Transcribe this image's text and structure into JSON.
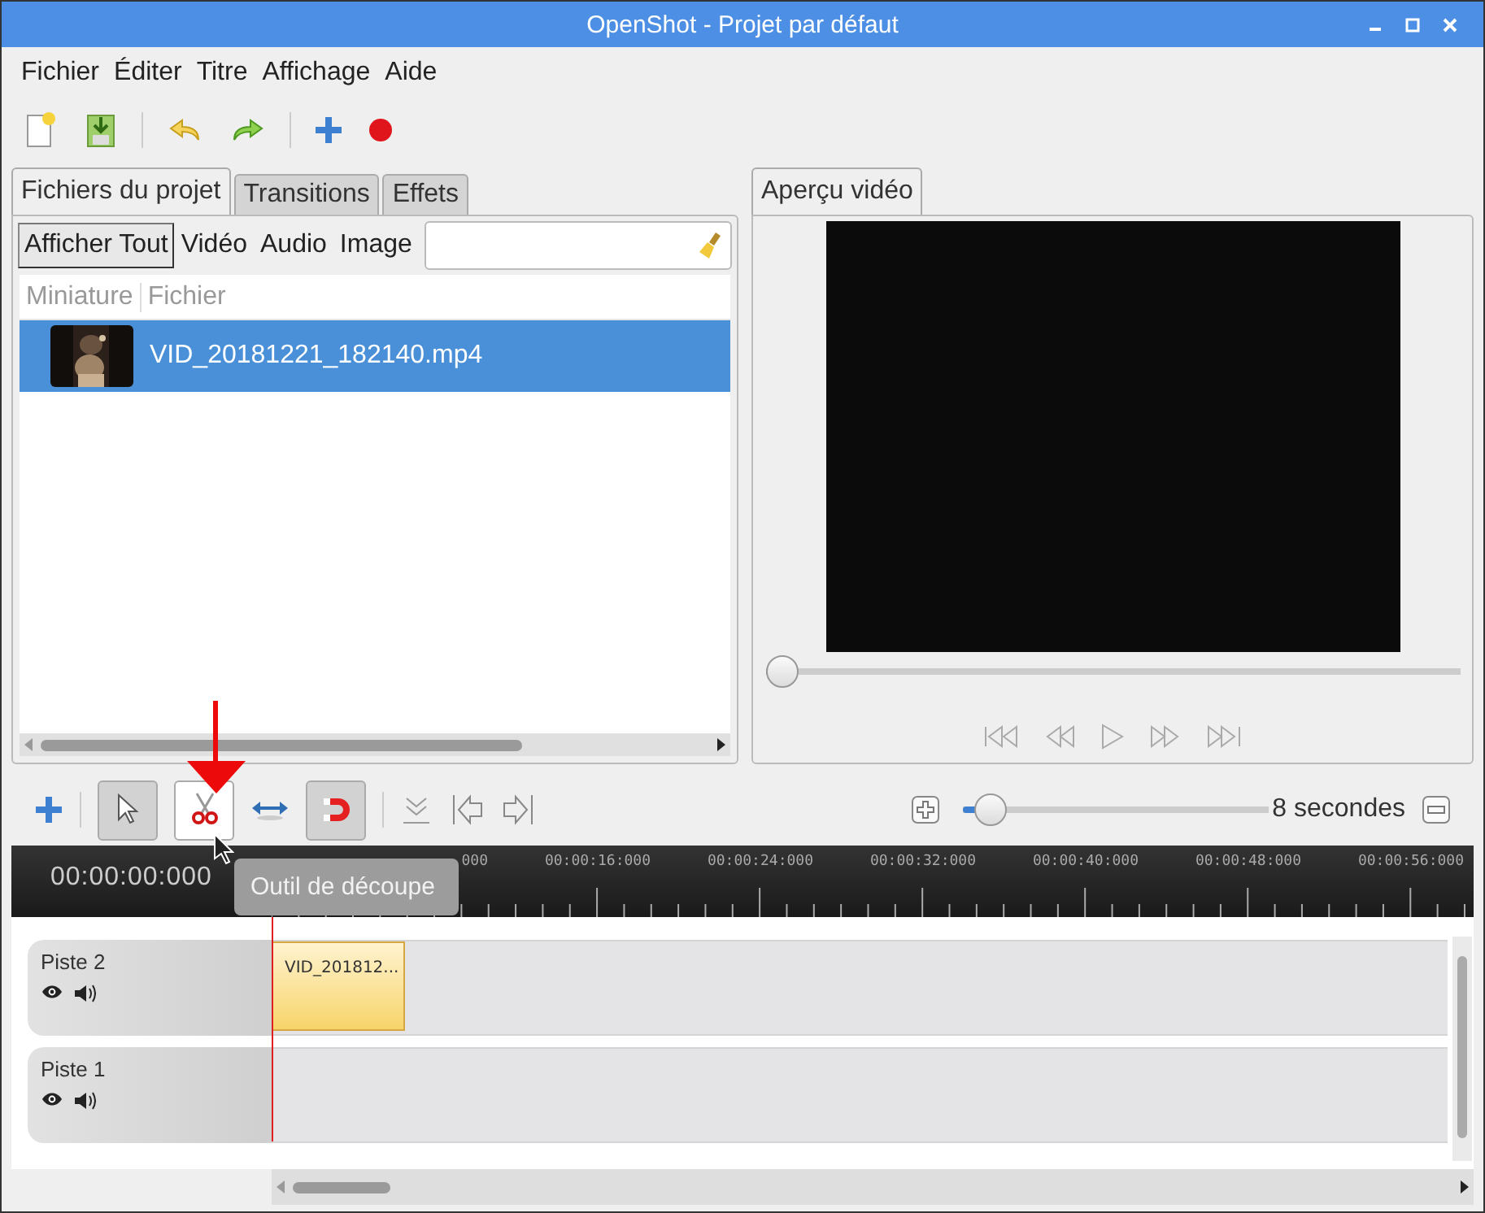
{
  "window": {
    "title": "OpenShot - Projet par défaut"
  },
  "menu": [
    "Fichier",
    "Éditer",
    "Titre",
    "Affichage",
    "Aide"
  ],
  "project_tabs": [
    {
      "label": "Fichiers du projet",
      "selected": true
    },
    {
      "label": "Transitions",
      "selected": false
    },
    {
      "label": "Effets",
      "selected": false
    }
  ],
  "filters": [
    {
      "label": "Afficher Tout",
      "selected": true
    },
    {
      "label": "Vidéo",
      "selected": false
    },
    {
      "label": "Audio",
      "selected": false
    },
    {
      "label": "Image",
      "selected": false
    }
  ],
  "files": {
    "columns": [
      "Miniature",
      "Fichier"
    ],
    "rows": [
      {
        "name": "VID_20181221_182140.mp4",
        "selected": true
      }
    ]
  },
  "preview": {
    "tab": {
      "label": "Aperçu vidéo",
      "selected": true
    },
    "seek": {
      "level": 0
    }
  },
  "tools": [
    {
      "kind": "add"
    },
    {
      "kind": "pointer",
      "on": true
    },
    {
      "kind": "razor",
      "on": false
    },
    {
      "kind": "arrows"
    },
    {
      "kind": "snap",
      "on": true
    },
    {
      "kind": "marker"
    },
    {
      "kind": "prev"
    },
    {
      "kind": "next"
    }
  ],
  "zoom": {
    "level": 0.04,
    "label": "8 secondes"
  },
  "timeline": {
    "timecode": "00:00:00:000",
    "ticks": [
      "000",
      "00:00:16:000",
      "00:00:24:000",
      "00:00:32:000",
      "00:00:40:000",
      "00:00:48:000",
      "00:00:56:000"
    ],
    "tracks": [
      {
        "name": "Piste 2",
        "clips": [
          {
            "label": "VID_201812..."
          }
        ]
      },
      {
        "name": "Piste 1"
      }
    ]
  },
  "tooltip": "Outil de découpe"
}
